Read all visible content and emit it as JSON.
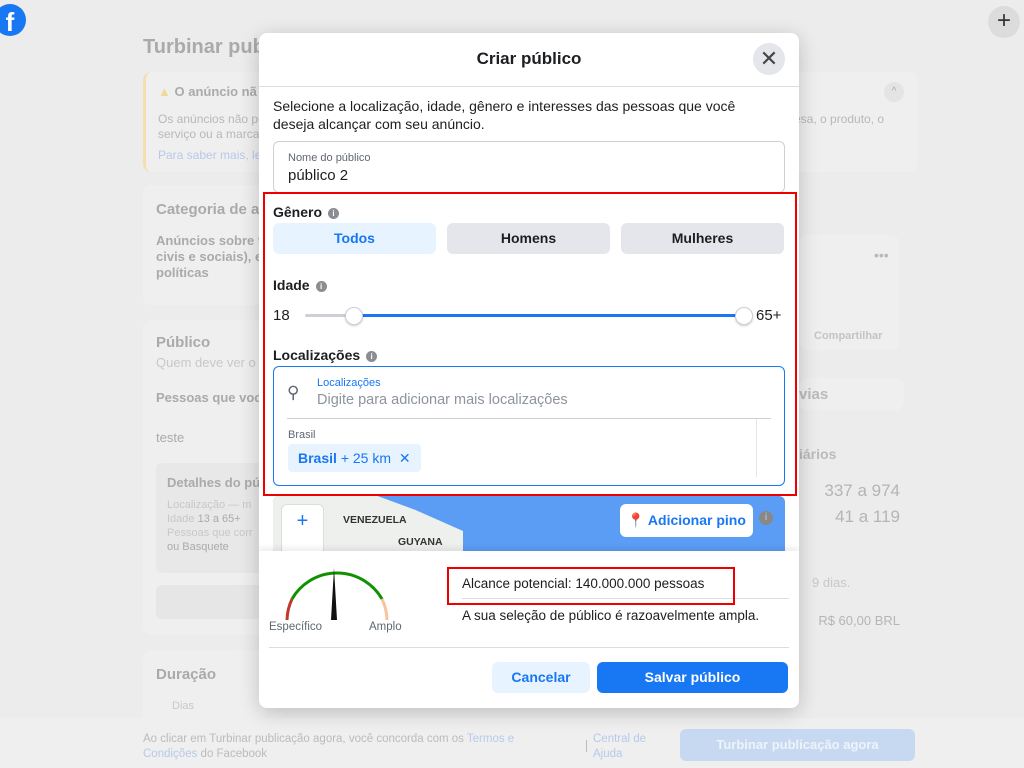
{
  "background": {
    "title": "Turbinar pub",
    "warning_title": "O anúncio nã",
    "warning_text_1": "Os anúncios não po",
    "warning_text_2": "serviço ou a marca",
    "warning_link": "Para saber mais, lei",
    "warning_right": "esa, o produto, o",
    "category_title": "Categoria de a",
    "category_text": [
      "Anúncios sobre t",
      "civis e sociais), e",
      "políticas"
    ],
    "audience_title": "Público",
    "audience_sub": "Quem deve ver o",
    "audience_people": "Pessoas que voc",
    "audience_name": "teste",
    "details_title": "Detalhes do pú",
    "details_location": "Localização — m",
    "details_age_label": "Idade",
    "details_age_value": "13 a 65+",
    "details_people": "Pessoas que corr",
    "details_interest": "ou Basquete",
    "duration_title": "Duração",
    "days_label": "Dias",
    "share": "Compartilhar",
    "previews": "vias",
    "daily": "iários",
    "stat1": "337 a 974",
    "stat2": "41 a 119",
    "days_note": "9 dias.",
    "budget": "R$ 60,00 BRL",
    "footer_text": "Ao clicar em Turbinar publicação agora, você concorda com os",
    "footer_link": "Termos e Condições",
    "footer_suffix": "do Facebook",
    "help_link": "Central de Ajuda",
    "boost_button": "Turbinar publicação agora"
  },
  "modal": {
    "title": "Criar público",
    "intro": "Selecione a localização, idade, gênero e interesses das pessoas que você deseja alcançar com seu anúncio.",
    "name_label": "Nome do público",
    "name_value": "público 2",
    "gender_label": "Gênero",
    "gender_options": [
      "Todos",
      "Homens",
      "Mulheres"
    ],
    "gender_selected": "Todos",
    "age_label": "Idade",
    "age_min": "18",
    "age_max": "65+",
    "locations_label": "Localizações",
    "locations_field_label": "Localizações",
    "locations_placeholder": "Digite para adicionar mais localizações",
    "country_group": "Brasil",
    "location_chip": "Brasil",
    "location_radius": "+ 25 km",
    "map_labels": [
      "VENEZUELA",
      "GUYANA"
    ],
    "add_pin": "Adicionar pino",
    "gauge_left": "Específico",
    "gauge_right": "Amplo",
    "reach": "Alcance potencial: 140.000.000 pessoas",
    "reach_note": "A sua seleção de público é razoavelmente ampla.",
    "cancel": "Cancelar",
    "save": "Salvar público"
  },
  "colors": {
    "accent": "#1877f2",
    "highlight": "#e00000"
  }
}
